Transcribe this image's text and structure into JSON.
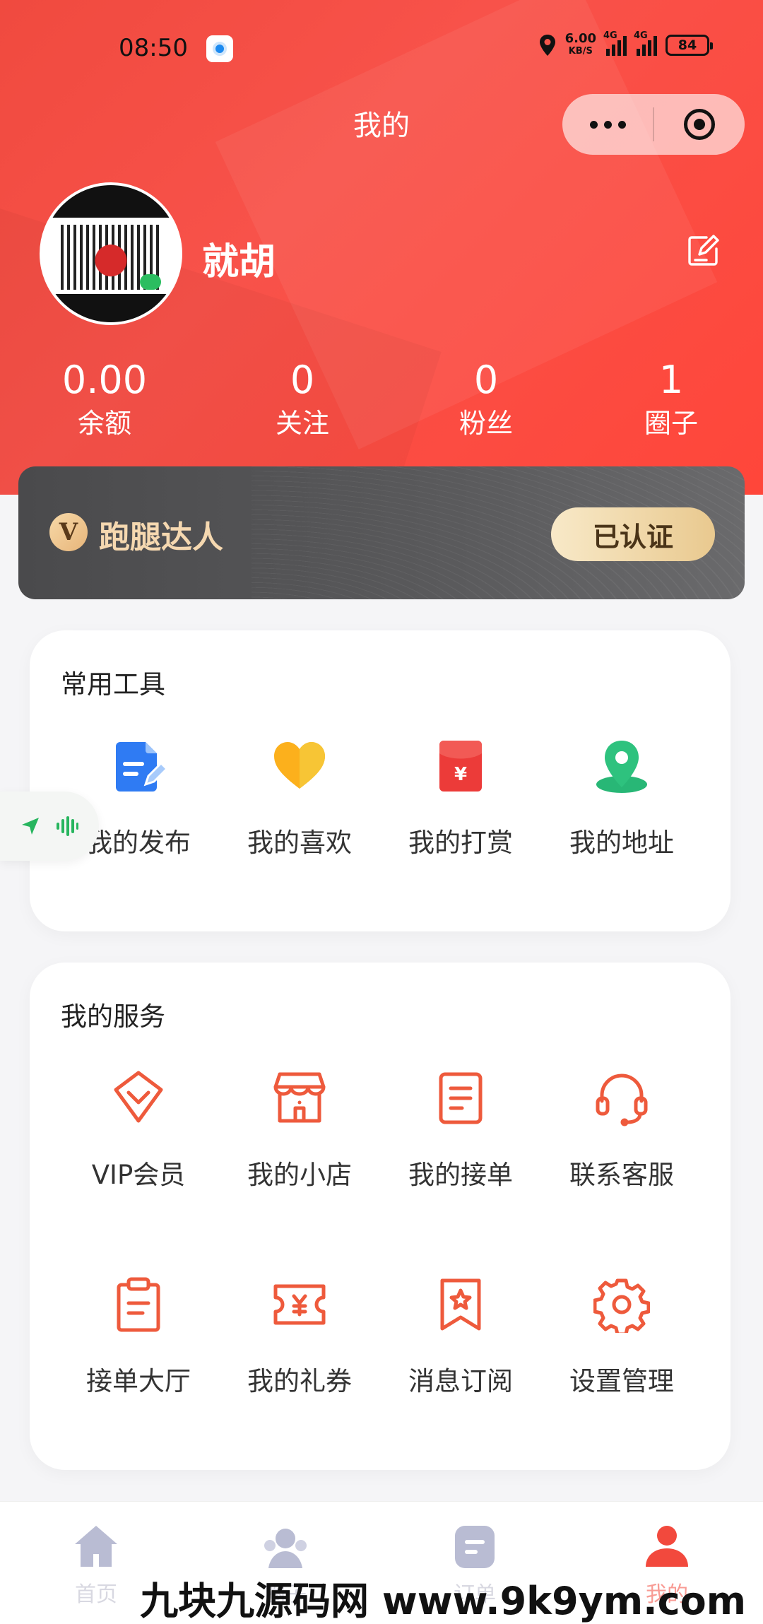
{
  "status_bar": {
    "time": "08:50",
    "net_speed_value": "6.00",
    "net_speed_unit": "KB/S",
    "signal1_label": "4G",
    "signal2_label": "4G",
    "battery": "84"
  },
  "nav": {
    "title": "我的"
  },
  "profile": {
    "username": "就胡"
  },
  "stats": [
    {
      "value": "0.00",
      "label": "余额"
    },
    {
      "value": "0",
      "label": "关注"
    },
    {
      "value": "0",
      "label": "粉丝"
    },
    {
      "value": "1",
      "label": "圈子"
    }
  ],
  "vip_card": {
    "badge": "V",
    "title": "跑腿达人",
    "status": "已认证"
  },
  "tools": {
    "title": "常用工具",
    "items": [
      {
        "label": "我的发布",
        "icon": "document-icon"
      },
      {
        "label": "我的喜欢",
        "icon": "heart-icon"
      },
      {
        "label": "我的打赏",
        "icon": "red-envelope-icon"
      },
      {
        "label": "我的地址",
        "icon": "location-pin-icon"
      }
    ]
  },
  "services": {
    "title": "我的服务",
    "items": [
      {
        "label": "VIP会员",
        "icon": "diamond-icon"
      },
      {
        "label": "我的小店",
        "icon": "shop-icon"
      },
      {
        "label": "我的接单",
        "icon": "order-list-icon"
      },
      {
        "label": "联系客服",
        "icon": "headset-icon"
      },
      {
        "label": "接单大厅",
        "icon": "clipboard-icon"
      },
      {
        "label": "我的礼券",
        "icon": "coupon-icon"
      },
      {
        "label": "消息订阅",
        "icon": "bookmark-star-icon"
      },
      {
        "label": "设置管理",
        "icon": "gear-icon"
      }
    ]
  },
  "tabbar": [
    {
      "label": "首页",
      "icon": "home-icon",
      "active": false
    },
    {
      "label": "圈子",
      "icon": "circle-community-icon",
      "active": false
    },
    {
      "label": "订单",
      "icon": "order-icon",
      "active": false
    },
    {
      "label": "我的",
      "icon": "user-icon",
      "active": true
    }
  ],
  "watermark": "九块九源码网 www.9k9ym.com",
  "colors": {
    "brand_red": "#f2493d",
    "icon_orange": "#ee5a3c",
    "vip_gold": "#f5d8b0",
    "vip_dark": "#4a4a4c"
  }
}
